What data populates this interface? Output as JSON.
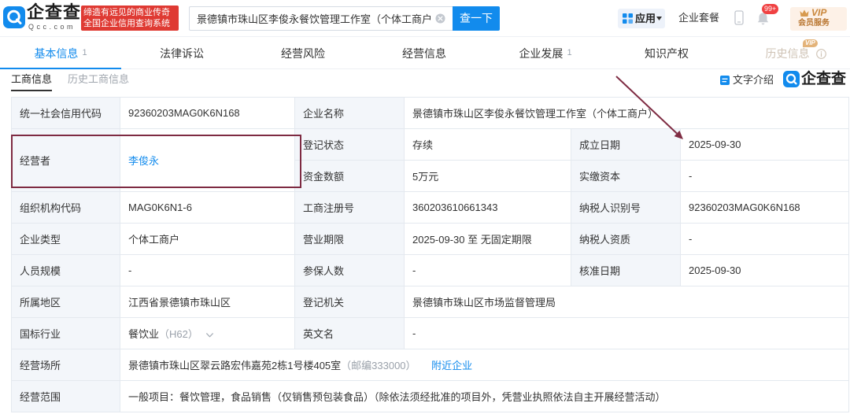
{
  "colors": {
    "brand": "#128bed",
    "badge_red": "#f04142",
    "vip_gold": "#c9873c",
    "annotation": "#7e2b42"
  },
  "icons": {
    "logo": "qcc-logo-icon",
    "search_clear": "close-circle-icon",
    "apps": "grid-icon",
    "phone": "phone-icon",
    "notifications": "bell-icon",
    "vip": "crown-icon",
    "history_info": "info-icon",
    "text_intro": "document-icon",
    "expand": "chevron-down-icon"
  },
  "header": {
    "logo_text": "企查查",
    "logo_domain": "Qcc.com",
    "slogan_line1": "缔造有远见的商业传奇",
    "slogan_line2": "全国企业信用查询系统",
    "search_value": "景德镇市珠山区李俊永餐饮管理工作室（个体工商户）",
    "search_button": "查一下",
    "apps_label": "应用",
    "plans_label": "企业套餐",
    "notification_badge": "99+",
    "vip_label": "VIP",
    "vip_sub": "会员服务"
  },
  "tabs": [
    {
      "label": "基本信息",
      "count": "1",
      "active": true
    },
    {
      "label": "法律诉讼"
    },
    {
      "label": "经营风险"
    },
    {
      "label": "经营信息"
    },
    {
      "label": "企业发展",
      "count": "1"
    },
    {
      "label": "知识产权"
    },
    {
      "label": "历史信息",
      "badge": "VIP"
    }
  ],
  "subtabs": [
    {
      "label": "工商信息",
      "active": true
    },
    {
      "label": "历史工商信息"
    }
  ],
  "toolbar": {
    "text_intro": "文字介绍",
    "brand_logo": "企查查"
  },
  "business_info": {
    "credit_code": {
      "label": "统一社会信用代码",
      "value": "92360203MAG0K6N168"
    },
    "company_name": {
      "label": "企业名称",
      "value": "景德镇市珠山区李俊永餐饮管理工作室（个体工商户）"
    },
    "operator": {
      "label": "经营者",
      "value": "李俊永"
    },
    "status": {
      "label": "登记状态",
      "value": "存续"
    },
    "established": {
      "label": "成立日期",
      "value": "2025-09-30"
    },
    "capital": {
      "label": "资金数额",
      "value": "5万元"
    },
    "paid_capital": {
      "label": "实缴资本",
      "value": "-"
    },
    "org_code": {
      "label": "组织机构代码",
      "value": "MAG0K6N1-6"
    },
    "reg_no": {
      "label": "工商注册号",
      "value": "360203610661343"
    },
    "taxpayer_id": {
      "label": "纳税人识别号",
      "value": "92360203MAG0K6N168"
    },
    "company_type": {
      "label": "企业类型",
      "value": "个体工商户"
    },
    "term": {
      "label": "营业期限",
      "value": "2025-09-30 至 无固定期限"
    },
    "taxpayer_qualification": {
      "label": "纳税人资质",
      "value": "-"
    },
    "staff_size": {
      "label": "人员规模",
      "value": "-"
    },
    "insured": {
      "label": "参保人数",
      "value": "-"
    },
    "approval_date": {
      "label": "核准日期",
      "value": "2025-09-30"
    },
    "region": {
      "label": "所属地区",
      "value": "江西省景德镇市珠山区"
    },
    "authority": {
      "label": "登记机关",
      "value": "景德镇市珠山区市场监督管理局"
    },
    "industry": {
      "label": "国标行业",
      "value": "餐饮业",
      "code": "（H62）"
    },
    "english_name": {
      "label": "英文名",
      "value": "-"
    },
    "address": {
      "label": "经营场所",
      "value": "景德镇市珠山区翠云路宏伟嘉苑2栋1号楼405室",
      "postcode": "（邮编333000）",
      "link": "附近企业"
    },
    "scope": {
      "label": "经营范围",
      "value": "一般项目：餐饮管理，食品销售（仅销售预包装食品）（除依法须经批准的项目外，凭营业执照依法自主开展经营活动）"
    }
  }
}
